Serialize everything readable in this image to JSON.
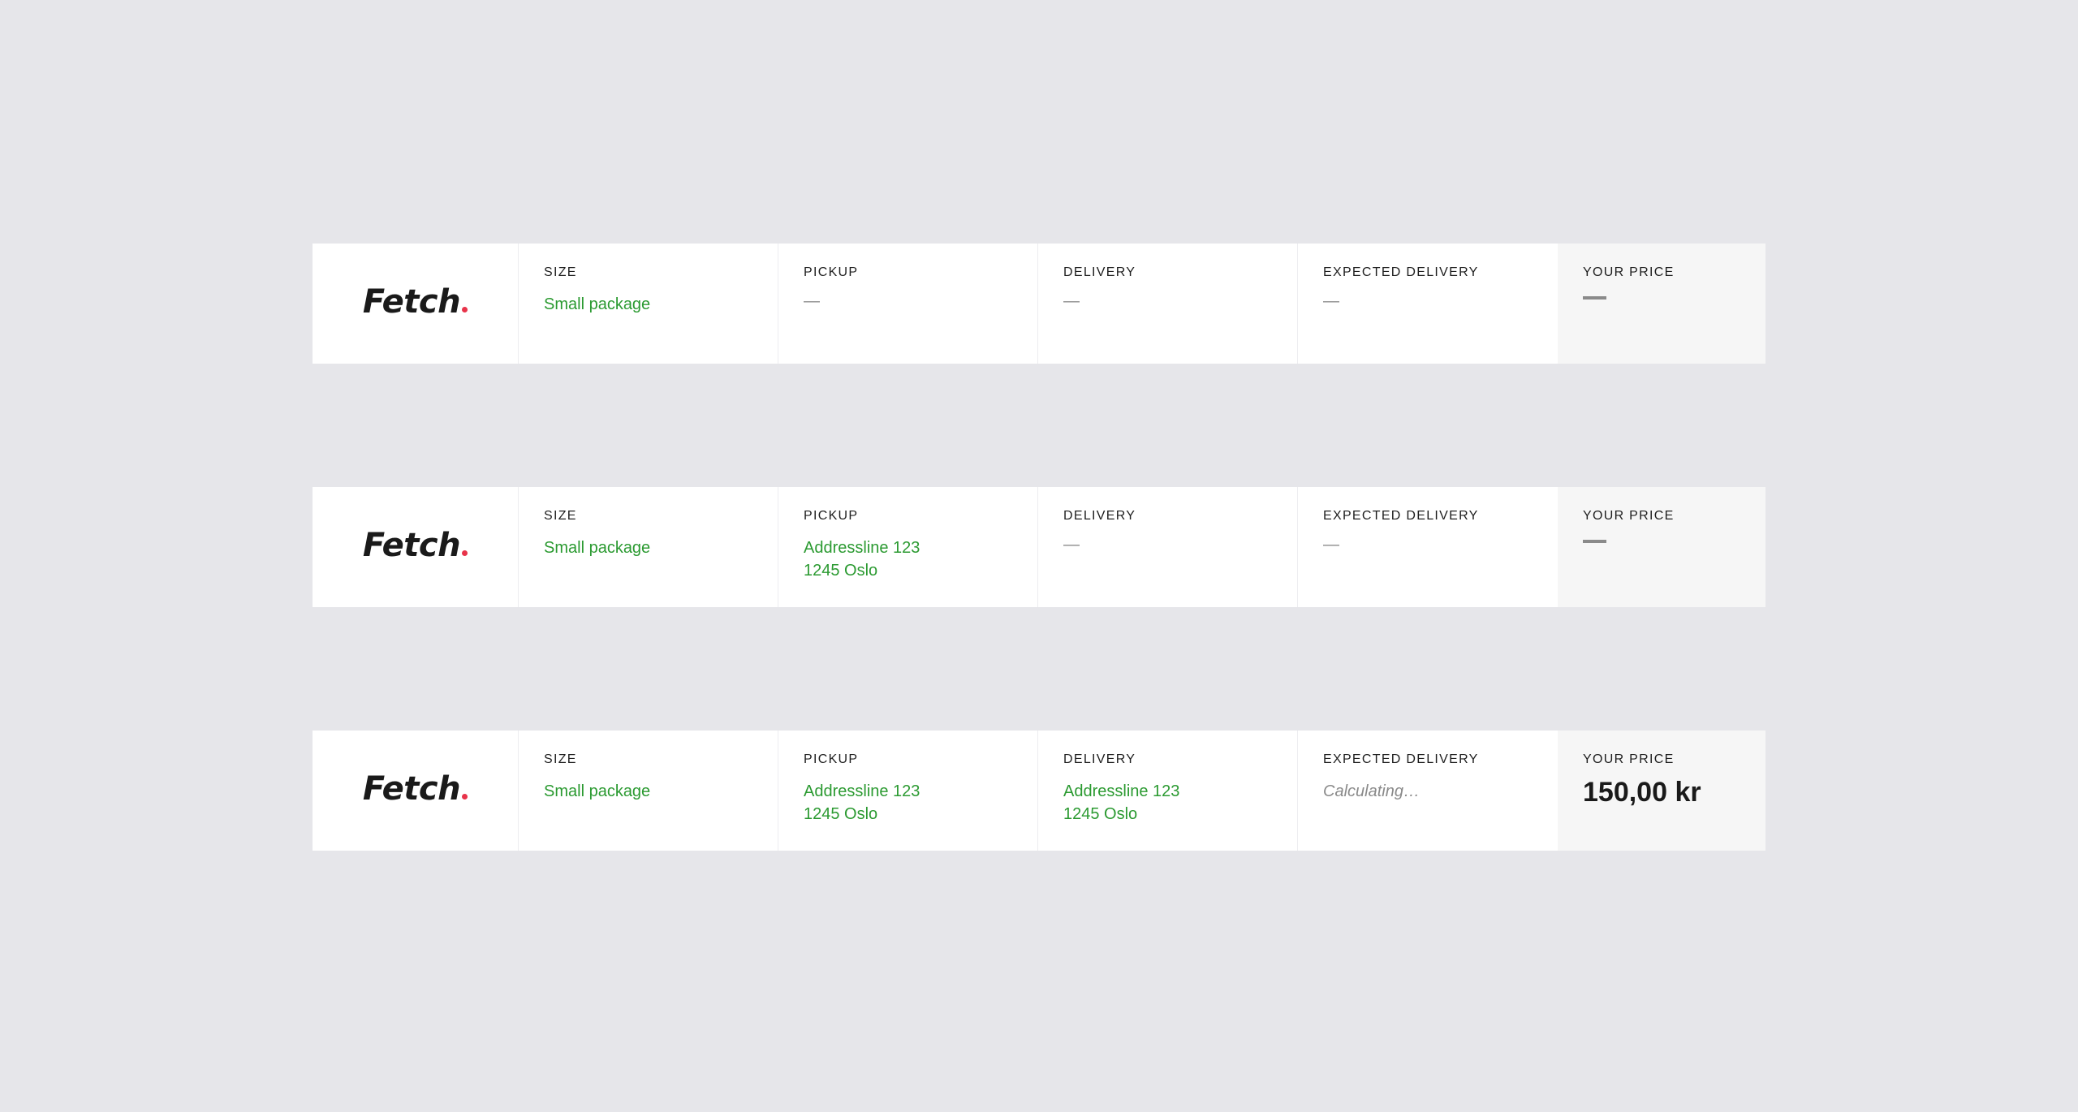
{
  "rows": [
    {
      "brand": "Fetch",
      "size_label": "SIZE",
      "size_value": "Small package",
      "pickup_label": "PICKUP",
      "pickup_value": "—",
      "delivery_label": "DELIVERY",
      "delivery_value": "—",
      "expected_label": "EXPECTED DELIVERY",
      "expected_value": "—",
      "price_label": "YOUR PRICE"
    },
    {
      "brand": "Fetch",
      "size_label": "SIZE",
      "size_value": "Small package",
      "pickup_label": "PICKUP",
      "pickup_line1": "Addressline 123",
      "pickup_line2": "1245 Oslo",
      "delivery_label": "DELIVERY",
      "delivery_value": "—",
      "expected_label": "EXPECTED DELIVERY",
      "expected_value": "—",
      "price_label": "YOUR PRICE"
    },
    {
      "brand": "Fetch",
      "size_label": "SIZE",
      "size_value": "Small package",
      "pickup_label": "PICKUP",
      "pickup_line1": "Addressline 123",
      "pickup_line2": "1245 Oslo",
      "delivery_label": "DELIVERY",
      "delivery_line1": "Addressline 123",
      "delivery_line2": "1245 Oslo",
      "expected_label": "EXPECTED DELIVERY",
      "expected_value": "Calculating…",
      "price_label": "YOUR PRICE",
      "price_value": "150,00 kr"
    }
  ],
  "colors": {
    "background": "#e6e6ea",
    "accent_green": "#2b9a31",
    "brand_dot": "#e8334a",
    "price_panel": "#f6f6f6"
  }
}
